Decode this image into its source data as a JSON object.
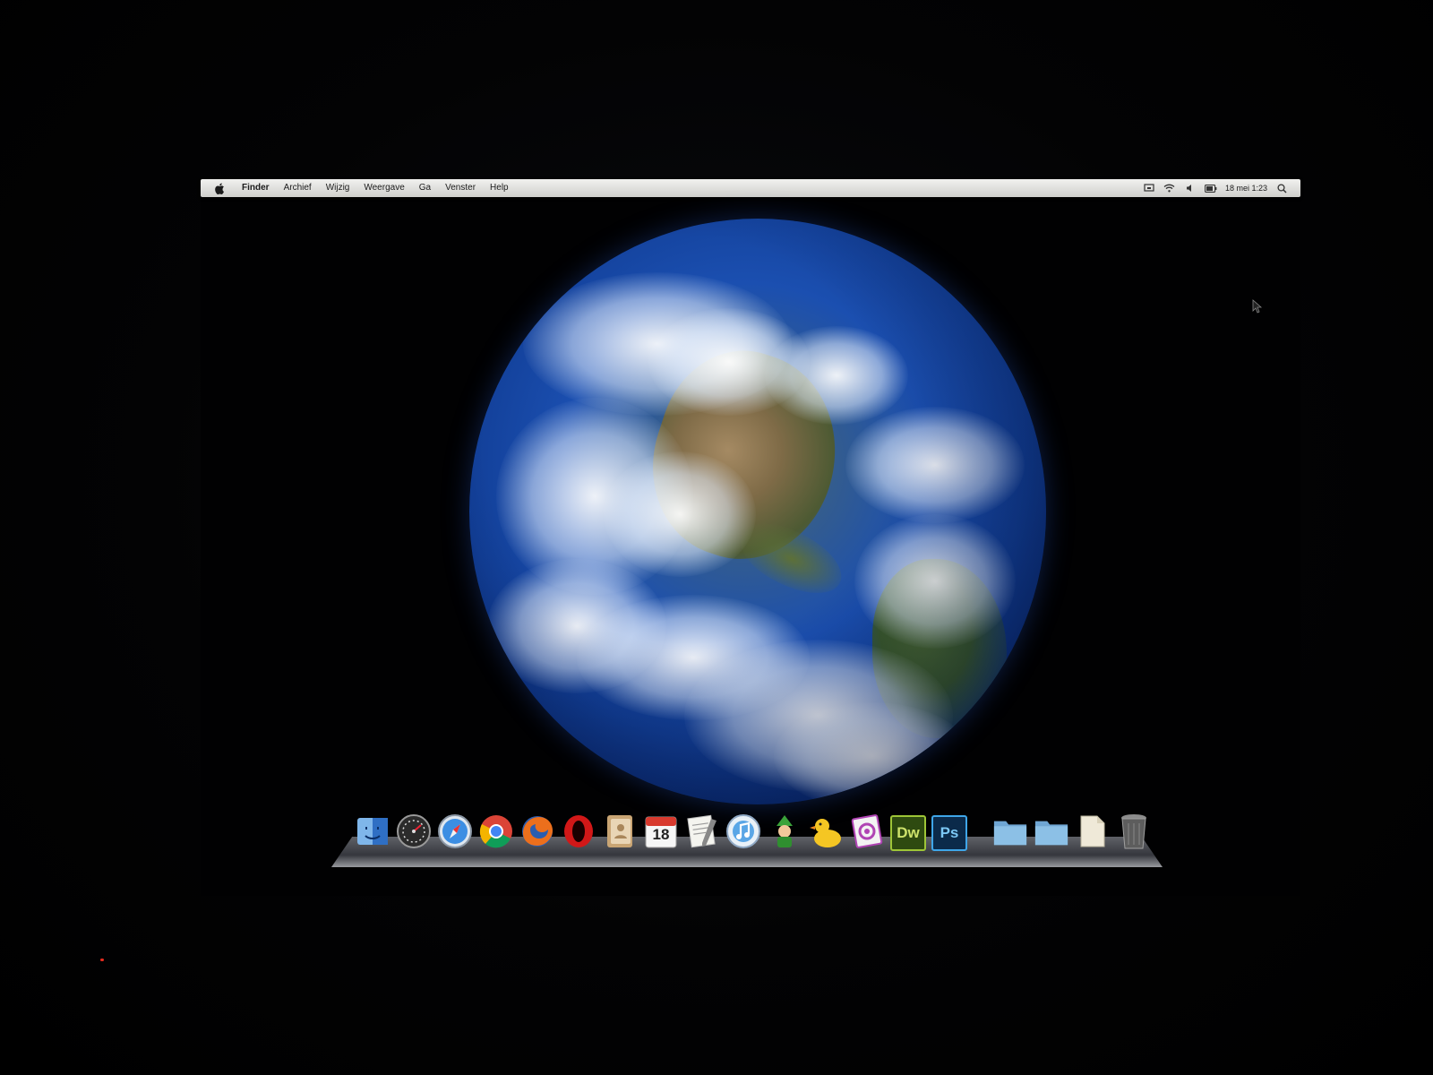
{
  "menubar": {
    "app_name": "Finder",
    "menus": [
      "Archief",
      "Wijzig",
      "Weergave",
      "Ga",
      "Venster",
      "Help"
    ],
    "status_icons": [
      "screen-mirroring-icon",
      "wifi-icon",
      "volume-icon",
      "battery-icon"
    ],
    "clock": "18 mei 1:23",
    "spotlight_icon": "spotlight-search-icon"
  },
  "desktop": {
    "wallpaper": "earth-globe",
    "colors": {
      "background": "#000000",
      "ocean": "#1b4fb0",
      "menubar": "#e4e4e2"
    }
  },
  "dock": {
    "apps": [
      {
        "name": "finder-icon"
      },
      {
        "name": "dashboard-icon"
      },
      {
        "name": "safari-icon"
      },
      {
        "name": "chrome-icon"
      },
      {
        "name": "firefox-icon"
      },
      {
        "name": "opera-icon"
      },
      {
        "name": "address-book-icon"
      },
      {
        "name": "ical-icon",
        "label": "18"
      },
      {
        "name": "textedit-icon"
      },
      {
        "name": "itunes-icon"
      },
      {
        "name": "adium-robot-icon"
      },
      {
        "name": "cyberduck-icon"
      },
      {
        "name": "photo-editor-icon"
      },
      {
        "name": "dreamweaver-icon",
        "label": "Dw"
      },
      {
        "name": "photoshop-icon",
        "label": "Ps"
      }
    ],
    "stacks": [
      {
        "name": "applications-folder-icon"
      },
      {
        "name": "documents-folder-icon"
      },
      {
        "name": "downloads-stack-icon"
      },
      {
        "name": "trash-icon"
      }
    ]
  }
}
